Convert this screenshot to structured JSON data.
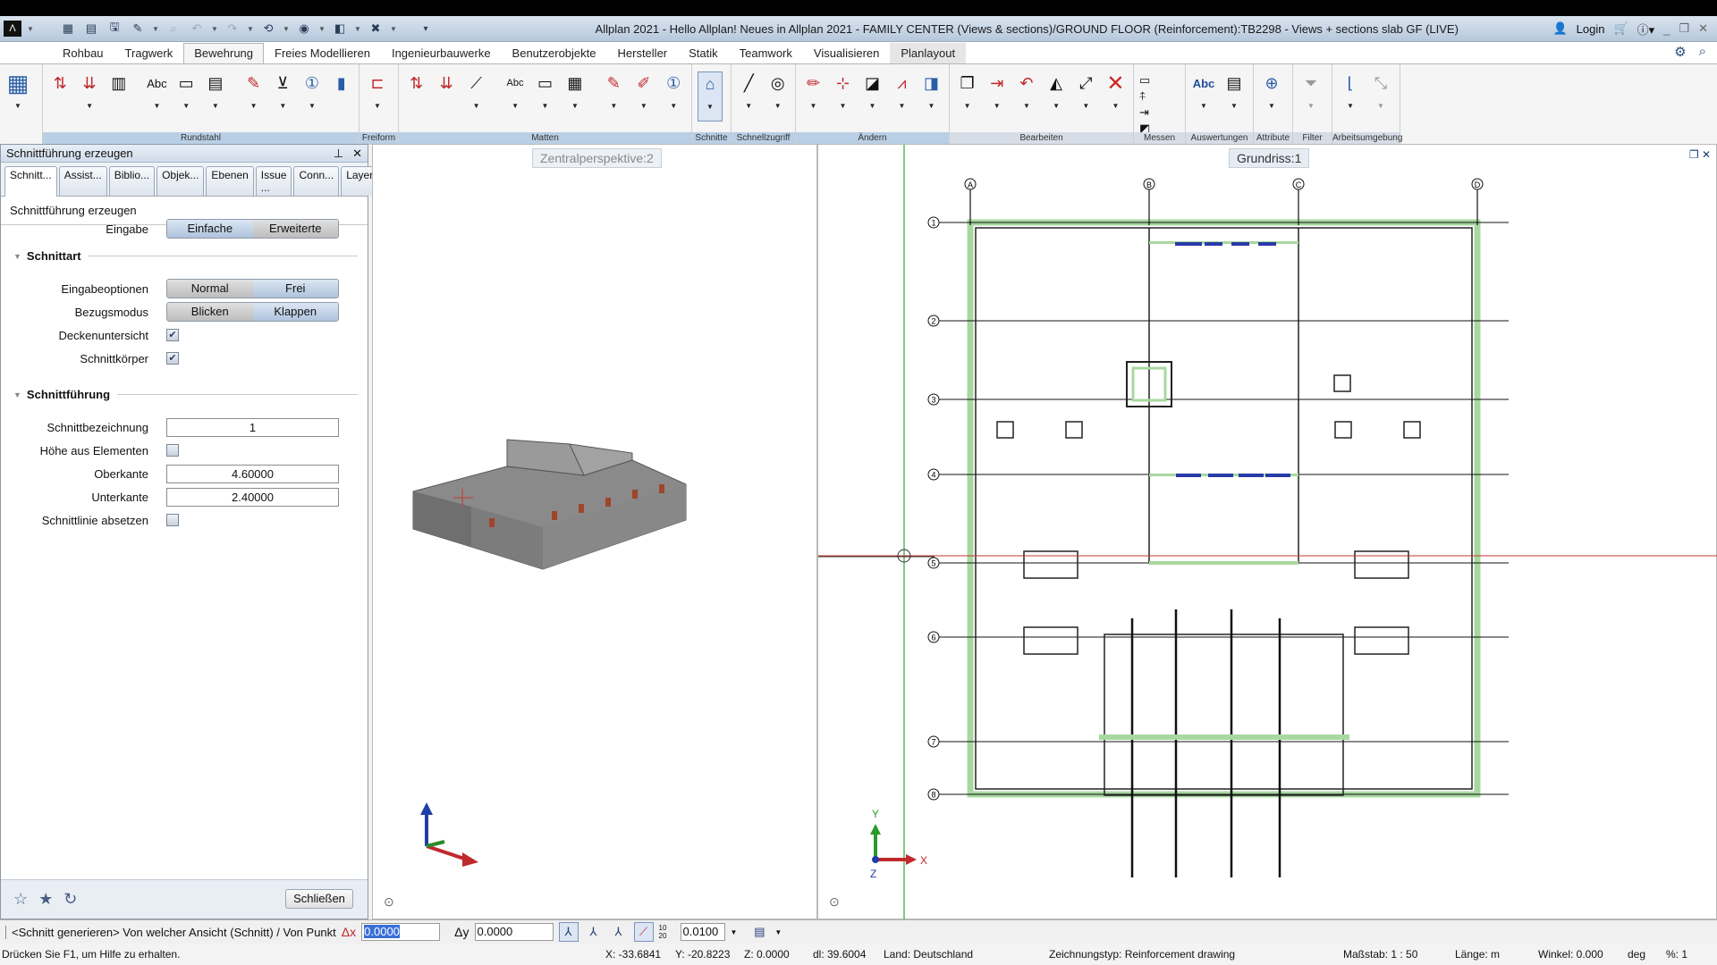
{
  "titlebar": {
    "title": "Allplan 2021 - Hello Allplan! Neues in Allplan 2021 - FAMILY CENTER (Views & sections)/GROUND FLOOR (Reinforcement):TB2298 - Views + sections slab GF (LIVE)",
    "login": "Login"
  },
  "ribbon_tabs": [
    "Rohbau",
    "Tragwerk",
    "Bewehrung",
    "Freies Modellieren",
    "Ingenieurbauwerke",
    "Benutzerobjekte",
    "Hersteller",
    "Statik",
    "Teamwork",
    "Visualisieren",
    "Planlayout"
  ],
  "ribbon_active_tab": "Bewehrung",
  "ribbon_groups": [
    "Rundstahl",
    "Freiform",
    "Matten",
    "Schnitte",
    "Schnellzugriff",
    "Ändern",
    "Bearbeiten",
    "Messen",
    "Auswertungen",
    "Attribute",
    "Filter",
    "Arbeitsumgebung"
  ],
  "panel": {
    "title": "Schnittführung erzeugen",
    "tabs": [
      "Schnitt...",
      "Assist...",
      "Biblio...",
      "Objek...",
      "Ebenen",
      "Issue ...",
      "Conn...",
      "Layer"
    ],
    "subtitle": "Schnittführung erzeugen",
    "eingabe": {
      "label": "Eingabe",
      "options": [
        "Einfache",
        "Erweiterte"
      ],
      "selected": "Einfache"
    },
    "section1": "Schnittart",
    "eingabeoptionen": {
      "label": "Eingabeoptionen",
      "options": [
        "Normal",
        "Frei"
      ],
      "selected": "Normal"
    },
    "bezugsmodus": {
      "label": "Bezugsmodus",
      "options": [
        "Blicken",
        "Klappen"
      ],
      "selected": "Blicken"
    },
    "deckenuntersicht": {
      "label": "Deckenuntersicht",
      "checked": true
    },
    "schnittkoerper": {
      "label": "Schnittkörper",
      "checked": true
    },
    "section2": "Schnittführung",
    "schnittbezeichnung": {
      "label": "Schnittbezeichnung",
      "value": "1"
    },
    "hoehe": {
      "label": "Höhe aus Elementen",
      "checked": false
    },
    "oberkante": {
      "label": "Oberkante",
      "value": "4.60000"
    },
    "unterkante": {
      "label": "Unterkante",
      "value": "2.40000"
    },
    "absetzen": {
      "label": "Schnittlinie absetzen",
      "checked": false
    },
    "close_label": "Schließen"
  },
  "viewports": {
    "left_tag": "Zentralperspektive:2",
    "right_tag": "Grundriss:1",
    "grid_columns": [
      "A",
      "B",
      "C",
      "D"
    ],
    "grid_rows": [
      "1",
      "2",
      "3",
      "4",
      "5",
      "6",
      "7",
      "8"
    ],
    "axis_x": "X",
    "axis_y": "Y",
    "axis_z": "Z"
  },
  "cmdbar": {
    "prompt": "<Schnitt generieren> Von welcher Ansicht (Schnitt) / Von Punkt",
    "dx_label": "Δx",
    "dx_value": "0.0000",
    "dy_label": "Δy",
    "dy_value": "0.0000",
    "snap_value": "0.0100",
    "snap_label": "10 20"
  },
  "statusbar": {
    "help": "Drücken Sie F1, um Hilfe zu erhalten.",
    "x": "X:   -33.6841",
    "y": "Y:   -20.8223",
    "z": "Z:   0.0000",
    "dl": "dl:   39.6004",
    "land": "Land:   Deutschland",
    "zeichnungstyp": "Zeichnungstyp:   Reinforcement drawing",
    "massstab": "Maßstab:   1 : 50",
    "laenge": "Länge:   m",
    "winkel": "Winkel:   0.000",
    "deg": "deg",
    "prozent": "%:   1"
  },
  "colors": {
    "accent": "#b9cfe5",
    "green_wall": "#9fd39a",
    "section_line": "#c0392b",
    "blue_rebar": "#2a3aa8"
  }
}
